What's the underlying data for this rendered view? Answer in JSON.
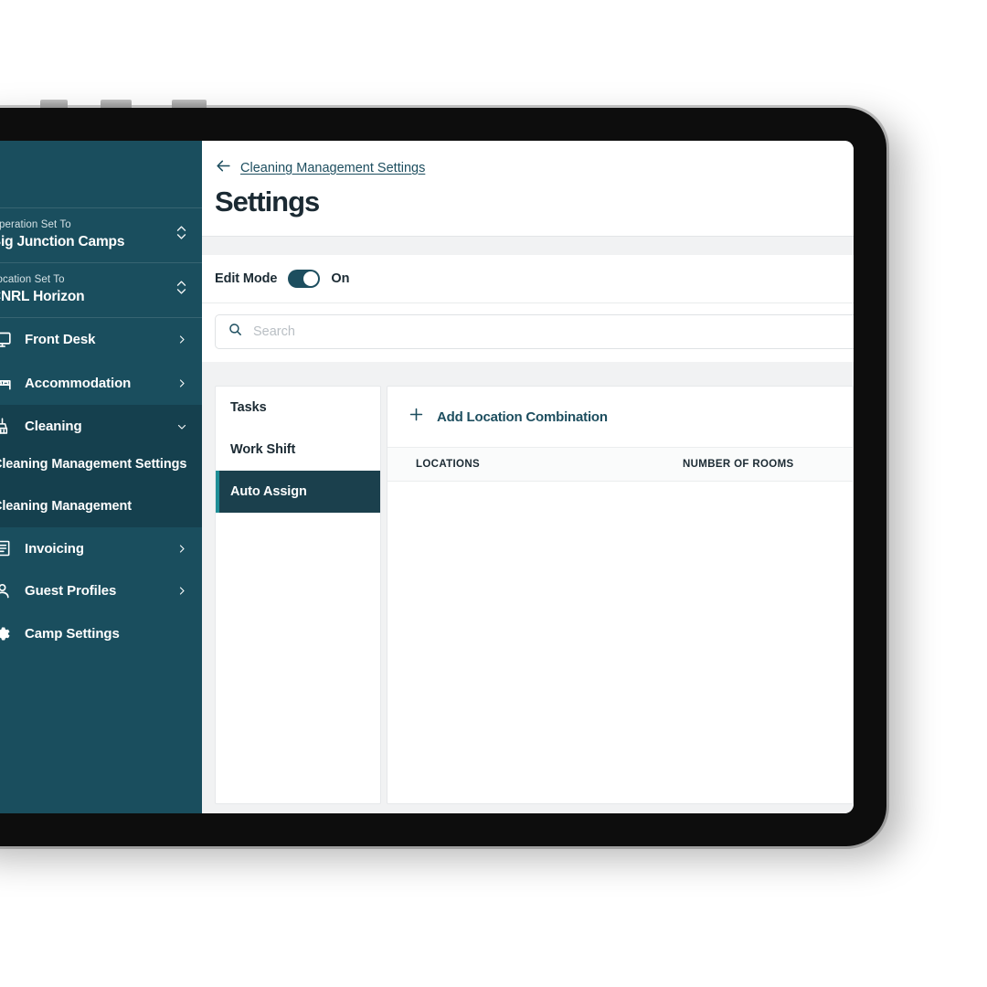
{
  "sidebar": {
    "context": [
      {
        "label": "Operation Set To",
        "value": "Big Junction Camps",
        "icon": "up-down-chevron-icon"
      },
      {
        "label": "Location Set To",
        "value": "CNRL Horizon",
        "icon": "up-down-chevron-icon"
      }
    ],
    "nav": [
      {
        "label": "Front Desk",
        "icon": "monitor-icon",
        "chevron": "chevron-right-icon"
      },
      {
        "label": "Accommodation",
        "icon": "bed-icon",
        "chevron": "chevron-right-icon"
      },
      {
        "label": "Cleaning",
        "icon": "broom-icon",
        "chevron": "chevron-down-icon",
        "expanded": true
      },
      {
        "label": "Invoicing",
        "icon": "invoice-icon",
        "chevron": "chevron-right-icon"
      },
      {
        "label": "Guest Profiles",
        "icon": "person-icon",
        "chevron": "chevron-right-icon"
      },
      {
        "label": "Camp Settings",
        "icon": "gear-icon",
        "chevron": ""
      }
    ],
    "cleaning_children": [
      {
        "label": "Cleaning Management Settings"
      },
      {
        "label": "Cleaning Management"
      }
    ],
    "accent_color": "#1f8e96",
    "background_color": "#1a4e5e",
    "active_group_color": "#15404e"
  },
  "header": {
    "breadcrumb": "Cleaning Management Settings",
    "back_icon": "arrow-left-icon",
    "title": "Settings"
  },
  "edit_mode": {
    "label": "Edit Mode",
    "state": "On",
    "toggle_on": true,
    "toggle_color": "#1d4e5f"
  },
  "search": {
    "placeholder": "Search",
    "value": "",
    "icon": "search-icon"
  },
  "tabs": [
    {
      "label": "Tasks",
      "active": false
    },
    {
      "label": "Work Shift",
      "active": false
    },
    {
      "label": "Auto Assign",
      "active": true
    }
  ],
  "content": {
    "add_button": {
      "label": "Add Location Combination",
      "icon": "plus-icon",
      "color": "#1d4e5f"
    },
    "table": {
      "columns": [
        "LOCATIONS",
        "NUMBER OF ROOMS"
      ],
      "rows": []
    }
  }
}
